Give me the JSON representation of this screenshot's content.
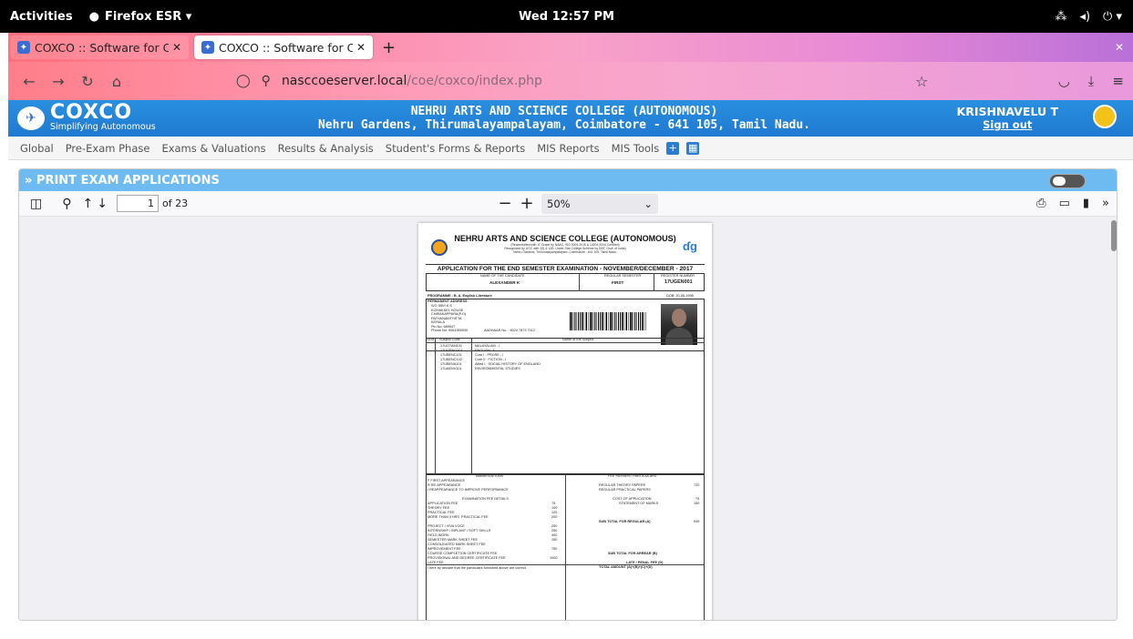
{
  "topbar": {
    "activities": "Activities",
    "app": "Firefox ESR ▾",
    "clock": "Wed 12:57 PM"
  },
  "tabs": [
    {
      "title": "COXCO :: Software for Co",
      "active": false
    },
    {
      "title": "COXCO :: Software for Co",
      "active": true
    }
  ],
  "url": {
    "host": "nasccoeserver.local",
    "path": "/coe/coxco/index.php"
  },
  "banner": {
    "brand": "COXCO",
    "tagline": "Simplifying Autonomous",
    "college_line1": "NEHRU ARTS AND SCIENCE COLLEGE (AUTONOMOUS)",
    "college_line2": "Nehru Gardens, Thirumalayampalayam, Coimbatore - 641 105, Tamil Nadu.",
    "user": "KRISHNAVELU T",
    "signout": "Sign out"
  },
  "menu": [
    "Global",
    "Pre-Exam Phase",
    "Exams & Valuations",
    "Results & Analysis",
    "Student's Forms & Reports",
    "MIS Reports",
    "MIS Tools"
  ],
  "panel": {
    "title": "» PRINT EXAM APPLICATIONS"
  },
  "pdf": {
    "page": "1",
    "of": "of 23",
    "zoom": "50%"
  },
  "document": {
    "college": "NEHRU ARTS AND SCIENCE COLLEGE (AUTONOMOUS)",
    "reaccredited": "(Reaccredited with 'A' Grade by NAAC, ISO 9001:2015 & 14001:2004 Certified)",
    "recognized": "Recognized by UGC with 2(f) & 12B, Under Star College Scheme by DBT, Govt. of India)",
    "address": "Nehru Gardens, Thirumalayampalayam, Coimbatore - 641 105, Tamil Nadu.",
    "exam_title": "APPLICATION FOR THE END SEMESTER EXAMINATION - NOVEMBER/DECEMBER - 2017",
    "candidate_label": "NAME OF THE CANDIDATE",
    "candidate": "ALEXANDER K",
    "semester_label": "REGULAR SEMESTER",
    "semester": "FIRST",
    "regno_label": "REGISTER NUMBER",
    "regno": "17UGEN001",
    "programme": "PROGRAMME : B. A. English Literature",
    "dob": "DOB: 20-05-1998",
    "address_label": "PERMANENT ADDRESS",
    "address_lines": [
      "S/O SIBY.K.S",
      "KIZHAKKEL HOUSE",
      "CHIRAKAPPARA(P.O)",
      "PATHANAMTHITTA",
      "KERALA",
      "Pin No: 689547",
      "Phone No: 9061955930"
    ],
    "aadhar": "AADHAAR No. : 8024 7873 7012",
    "subjects": [
      {
        "code": "17UGTAM101",
        "name": "MALAYALAM - I"
      },
      {
        "code": "17UGENG101",
        "name": "ENGLISH - I"
      },
      {
        "code": "17UBENC101",
        "name": "Core I : PROSE - I"
      },
      {
        "code": "17UBENC102",
        "name": "Core II : FICTION - I"
      },
      {
        "code": "17UBENA101",
        "name": "Allied I : SOCIAL HISTORY OF ENGLAND"
      },
      {
        "code": "17UAENV101",
        "name": "ENVIRONMENTAL STUDIES"
      }
    ],
    "abbreviations": "ABBREVIATIONS",
    "abbr_rows": [
      "F  FIRST APPEARANCE",
      "R  RE-APPEARANCE",
      "I   REAPPEARANCE TO IMPROVE PERFORMANCE"
    ],
    "fees_label": "EXAMINATION FEE DETAILS",
    "fee_rows": [
      {
        "name": "APPLICATION FEE",
        "amt": "75"
      },
      {
        "name": "THEORY FEE",
        "amt": "100"
      },
      {
        "name": "PRACTICAL FEE",
        "amt": "125"
      },
      {
        "name": "MORE THAN 3 HRS. PRACTICAL FEE",
        "amt": "200"
      },
      {
        "name": "PROJECT / VIVA VOCE",
        "amt": "250"
      },
      {
        "name": "INTERNSHIP / INPLANT / SOFT SKILLS",
        "amt": "250"
      },
      {
        "name": "FIELD WORK",
        "amt": "400"
      },
      {
        "name": "SEMESTER MARK SHEET FEE",
        "amt": "150"
      },
      {
        "name": "CONSOLIDATED MARK SHEET FEE",
        "amt": ""
      },
      {
        "name": "IMPROVEMENT FEE",
        "amt": "750"
      },
      {
        "name": "COURSE COMPLETION CERTIFICATE FEE",
        "amt": ""
      },
      {
        "name": "PROVISIONAL AND DEGREE CERTIFICATE FEE",
        "amt": "1000"
      },
      {
        "name": "LATE FEE",
        "amt": ""
      }
    ],
    "payment_label": "FEE PAYMENT PARTICULARS",
    "payment_rows": [
      {
        "name": "REGULAR THEORY PAPERS",
        "amt": "720"
      },
      {
        "name": "REGULAR PRACTICAL PAPERS",
        "amt": ""
      },
      {
        "name": "COST OF APPLICATION",
        "amt": "75"
      },
      {
        "name": "STATEMENT OF MARKS",
        "amt": "150"
      },
      {
        "name": "SUB TOTAL FOR REGULAR (A)",
        "amt": "945"
      },
      {
        "name": "SUB TOTAL FOR ARREAR (B)",
        "amt": ""
      },
      {
        "name": "LATE / PENAL FEE (D)",
        "amt": ""
      },
      {
        "name": "TOTAL AMOUNT (A)+(B)+(C)+(D)",
        "amt": ""
      }
    ],
    "declaration": "I here by declare that the particulars furnished above are correct."
  }
}
